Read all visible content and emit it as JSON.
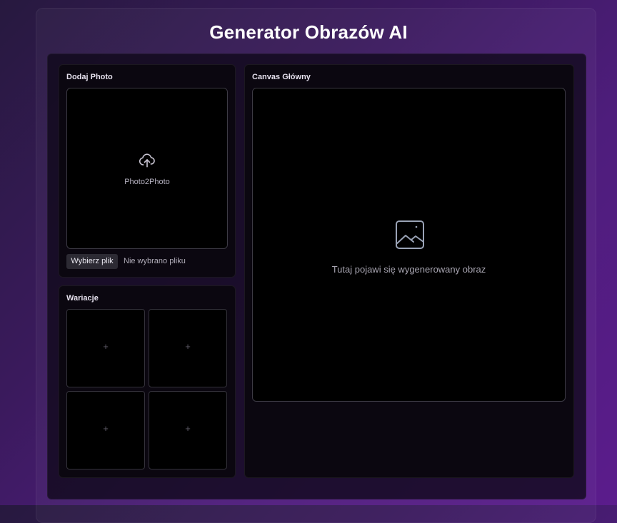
{
  "app": {
    "title": "Generator Obrazów AI"
  },
  "upload_panel": {
    "title": "Dodaj Photo",
    "dropzone_label": "Photo2Photo",
    "icon": "cloud-upload-icon",
    "file_button_label": "Wybierz plik",
    "file_status": "Nie wybrano pliku"
  },
  "variations_panel": {
    "title": "Wariacje",
    "tiles": [
      {
        "symbol": "+"
      },
      {
        "symbol": "+"
      },
      {
        "symbol": "+"
      },
      {
        "symbol": "+"
      }
    ]
  },
  "canvas_panel": {
    "title": "Canvas Główny",
    "icon": "image-icon",
    "placeholder": "Tutaj pojawi się wygenerowany obraz"
  },
  "colors": {
    "background_start": "#27193f",
    "background_end": "#5b1c8c",
    "card_background": "#0b0710",
    "dropzone_background": "#000000",
    "title_text": "#ffffff"
  }
}
